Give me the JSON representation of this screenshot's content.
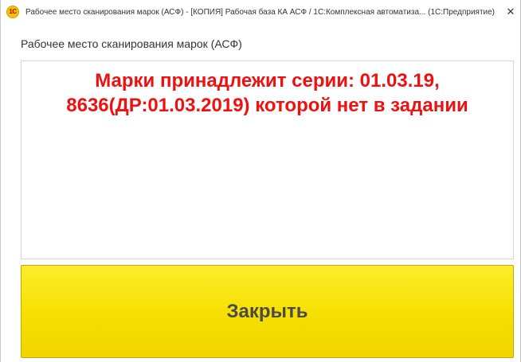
{
  "window": {
    "app_icon_text": "1С",
    "title": "Рабочее место сканирования марок (АСФ) - [КОПИЯ] Рабочая база КА АСФ / 1С:Комплексная автоматиза... (1С:Предприятие)",
    "close_glyph": "✕"
  },
  "form": {
    "title": "Рабочее место сканирования марок (АСФ)",
    "message": "Марки принадлежит серии: 01.03.19, 8636(ДР:01.03.2019)  которой нет в задании",
    "message_color": "#ee1111",
    "close_button_label": "Закрыть",
    "close_button_color": "#f6df00"
  },
  "icons": {
    "app": "1c-app-icon",
    "close": "close-icon"
  }
}
